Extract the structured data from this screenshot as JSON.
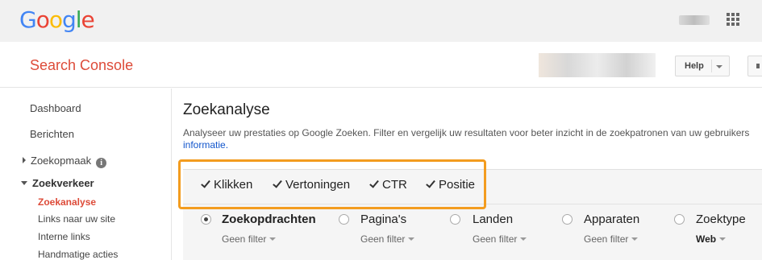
{
  "google_logo": {
    "letters": [
      "G",
      "o",
      "o",
      "g",
      "l",
      "e"
    ],
    "colors": [
      "#4285f4",
      "#ea4335",
      "#fbbc05",
      "#4285f4",
      "#34a853",
      "#ea4335"
    ]
  },
  "header": {
    "title": "Search Console",
    "help_label": "Help"
  },
  "sidebar": {
    "items": [
      {
        "label": "Dashboard"
      },
      {
        "label": "Berichten"
      },
      {
        "label": "Zoekopmaak"
      },
      {
        "label": "Zoekverkeer"
      },
      {
        "label": "Zoekanalyse"
      },
      {
        "label": "Links naar uw site"
      },
      {
        "label": "Interne links"
      },
      {
        "label": "Handmatige acties"
      }
    ],
    "info_glyph": "i"
  },
  "main": {
    "title": "Zoekanalyse",
    "description": "Analyseer uw prestaties op Google Zoeken. Filter en vergelijk uw resultaten voor beter inzicht in de zoekpatronen van uw gebruikers",
    "more_link": "informatie."
  },
  "metrics": [
    {
      "label": "Klikken",
      "checked": true
    },
    {
      "label": "Vertoningen",
      "checked": true
    },
    {
      "label": "CTR",
      "checked": true
    },
    {
      "label": "Positie",
      "checked": true
    }
  ],
  "dimensions": [
    {
      "label": "Zoekopdrachten",
      "filter": "Geen filter",
      "selected": true
    },
    {
      "label": "Pagina's",
      "filter": "Geen filter",
      "selected": false
    },
    {
      "label": "Landen",
      "filter": "Geen filter",
      "selected": false
    },
    {
      "label": "Apparaten",
      "filter": "Geen filter",
      "selected": false
    },
    {
      "label": "Zoektype",
      "filter": "Web",
      "selected": false
    }
  ],
  "colors": {
    "accent": "#dd4b39",
    "highlight": "#f39c1f",
    "link": "#1155cc"
  }
}
